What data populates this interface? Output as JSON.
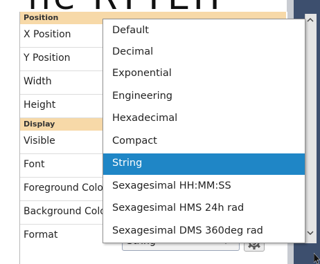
{
  "background_title": "ne RYTEH",
  "sections": [
    {
      "label": "Position"
    },
    {
      "label": "Display"
    }
  ],
  "properties": [
    {
      "label": "X Position"
    },
    {
      "label": "Y Position"
    },
    {
      "label": "Width"
    },
    {
      "label": "Height"
    },
    {
      "label": "Visible"
    },
    {
      "label": "Font"
    },
    {
      "label": "Foreground Color"
    },
    {
      "label": "Background Color"
    },
    {
      "label": "Format"
    }
  ],
  "format_combo": {
    "value": "String"
  },
  "dropdown": {
    "options": [
      "Default",
      "Decimal",
      "Exponential",
      "Engineering",
      "Hexadecimal",
      "Compact",
      "String",
      "Sexagesimal HH:MM:SS",
      "Sexagesimal HMS 24h rad",
      "Sexagesimal DMS 360deg rad"
    ],
    "selected": "String"
  },
  "colors": {
    "section_bg": "#f7d9a8",
    "selection": "#1f86c6",
    "panel_dark": "#3d4f6e"
  },
  "icons": [
    "gear-dollar-icon",
    "chevron-down-icon",
    "scroll-up-icon",
    "scroll-down-icon",
    "mouse-pointer-icon"
  ]
}
